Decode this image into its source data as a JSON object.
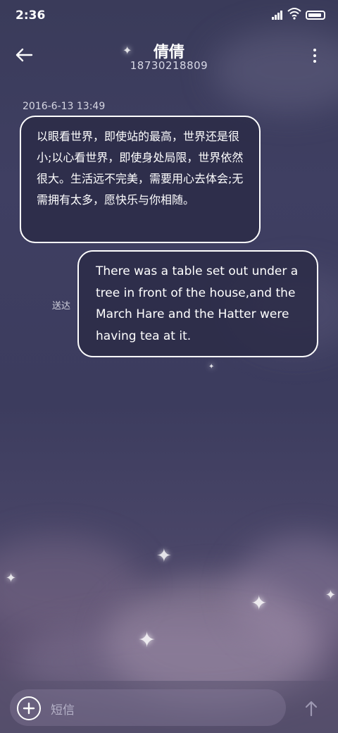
{
  "status_bar": {
    "time": "2:36",
    "battery_level": 0.9
  },
  "header": {
    "contact_name": "倩倩",
    "contact_number": "18730218809",
    "back_icon": "back-arrow-icon",
    "more_icon": "more-vertical-icon"
  },
  "conversation": {
    "timestamp": "2016-6-13 13:49",
    "messages": [
      {
        "direction": "incoming",
        "text": "以眼看世界，即使站的最高，世界还是很小;以心看世界，即使身处局限，世界依然很大。生活远不完美，需要用心去体会;无需拥有太多，愿快乐与你相随。"
      },
      {
        "direction": "outgoing",
        "text": "There was a table set out under a tree in front of the house,and the March Hare and the Hatter were having tea at it.",
        "status": "送达"
      }
    ]
  },
  "composer": {
    "placeholder": "短信",
    "add_icon": "plus-circle-icon",
    "send_icon": "send-arrow-icon"
  },
  "colors": {
    "background": "#3e3e60",
    "bubble_background": "#2c2c48",
    "bubble_border": "#ffffff",
    "text": "#ffffff"
  }
}
